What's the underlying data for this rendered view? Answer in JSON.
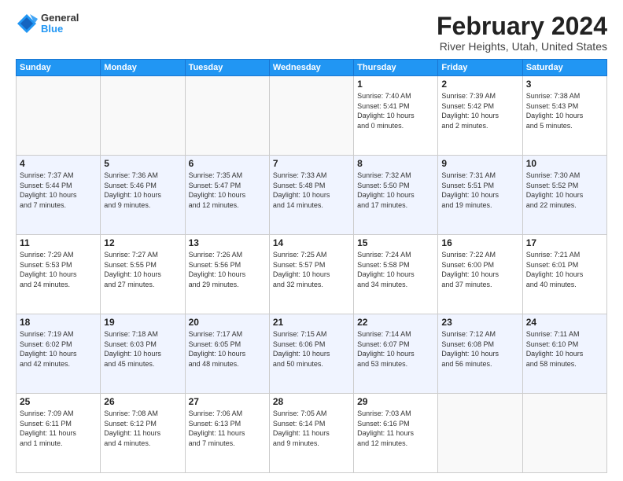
{
  "logo": {
    "general": "General",
    "blue": "Blue"
  },
  "header": {
    "title": "February 2024",
    "subtitle": "River Heights, Utah, United States"
  },
  "days_of_week": [
    "Sunday",
    "Monday",
    "Tuesday",
    "Wednesday",
    "Thursday",
    "Friday",
    "Saturday"
  ],
  "weeks": [
    [
      {
        "day": "",
        "detail": ""
      },
      {
        "day": "",
        "detail": ""
      },
      {
        "day": "",
        "detail": ""
      },
      {
        "day": "",
        "detail": ""
      },
      {
        "day": "1",
        "detail": "Sunrise: 7:40 AM\nSunset: 5:41 PM\nDaylight: 10 hours\nand 0 minutes."
      },
      {
        "day": "2",
        "detail": "Sunrise: 7:39 AM\nSunset: 5:42 PM\nDaylight: 10 hours\nand 2 minutes."
      },
      {
        "day": "3",
        "detail": "Sunrise: 7:38 AM\nSunset: 5:43 PM\nDaylight: 10 hours\nand 5 minutes."
      }
    ],
    [
      {
        "day": "4",
        "detail": "Sunrise: 7:37 AM\nSunset: 5:44 PM\nDaylight: 10 hours\nand 7 minutes."
      },
      {
        "day": "5",
        "detail": "Sunrise: 7:36 AM\nSunset: 5:46 PM\nDaylight: 10 hours\nand 9 minutes."
      },
      {
        "day": "6",
        "detail": "Sunrise: 7:35 AM\nSunset: 5:47 PM\nDaylight: 10 hours\nand 12 minutes."
      },
      {
        "day": "7",
        "detail": "Sunrise: 7:33 AM\nSunset: 5:48 PM\nDaylight: 10 hours\nand 14 minutes."
      },
      {
        "day": "8",
        "detail": "Sunrise: 7:32 AM\nSunset: 5:50 PM\nDaylight: 10 hours\nand 17 minutes."
      },
      {
        "day": "9",
        "detail": "Sunrise: 7:31 AM\nSunset: 5:51 PM\nDaylight: 10 hours\nand 19 minutes."
      },
      {
        "day": "10",
        "detail": "Sunrise: 7:30 AM\nSunset: 5:52 PM\nDaylight: 10 hours\nand 22 minutes."
      }
    ],
    [
      {
        "day": "11",
        "detail": "Sunrise: 7:29 AM\nSunset: 5:53 PM\nDaylight: 10 hours\nand 24 minutes."
      },
      {
        "day": "12",
        "detail": "Sunrise: 7:27 AM\nSunset: 5:55 PM\nDaylight: 10 hours\nand 27 minutes."
      },
      {
        "day": "13",
        "detail": "Sunrise: 7:26 AM\nSunset: 5:56 PM\nDaylight: 10 hours\nand 29 minutes."
      },
      {
        "day": "14",
        "detail": "Sunrise: 7:25 AM\nSunset: 5:57 PM\nDaylight: 10 hours\nand 32 minutes."
      },
      {
        "day": "15",
        "detail": "Sunrise: 7:24 AM\nSunset: 5:58 PM\nDaylight: 10 hours\nand 34 minutes."
      },
      {
        "day": "16",
        "detail": "Sunrise: 7:22 AM\nSunset: 6:00 PM\nDaylight: 10 hours\nand 37 minutes."
      },
      {
        "day": "17",
        "detail": "Sunrise: 7:21 AM\nSunset: 6:01 PM\nDaylight: 10 hours\nand 40 minutes."
      }
    ],
    [
      {
        "day": "18",
        "detail": "Sunrise: 7:19 AM\nSunset: 6:02 PM\nDaylight: 10 hours\nand 42 minutes."
      },
      {
        "day": "19",
        "detail": "Sunrise: 7:18 AM\nSunset: 6:03 PM\nDaylight: 10 hours\nand 45 minutes."
      },
      {
        "day": "20",
        "detail": "Sunrise: 7:17 AM\nSunset: 6:05 PM\nDaylight: 10 hours\nand 48 minutes."
      },
      {
        "day": "21",
        "detail": "Sunrise: 7:15 AM\nSunset: 6:06 PM\nDaylight: 10 hours\nand 50 minutes."
      },
      {
        "day": "22",
        "detail": "Sunrise: 7:14 AM\nSunset: 6:07 PM\nDaylight: 10 hours\nand 53 minutes."
      },
      {
        "day": "23",
        "detail": "Sunrise: 7:12 AM\nSunset: 6:08 PM\nDaylight: 10 hours\nand 56 minutes."
      },
      {
        "day": "24",
        "detail": "Sunrise: 7:11 AM\nSunset: 6:10 PM\nDaylight: 10 hours\nand 58 minutes."
      }
    ],
    [
      {
        "day": "25",
        "detail": "Sunrise: 7:09 AM\nSunset: 6:11 PM\nDaylight: 11 hours\nand 1 minute."
      },
      {
        "day": "26",
        "detail": "Sunrise: 7:08 AM\nSunset: 6:12 PM\nDaylight: 11 hours\nand 4 minutes."
      },
      {
        "day": "27",
        "detail": "Sunrise: 7:06 AM\nSunset: 6:13 PM\nDaylight: 11 hours\nand 7 minutes."
      },
      {
        "day": "28",
        "detail": "Sunrise: 7:05 AM\nSunset: 6:14 PM\nDaylight: 11 hours\nand 9 minutes."
      },
      {
        "day": "29",
        "detail": "Sunrise: 7:03 AM\nSunset: 6:16 PM\nDaylight: 11 hours\nand 12 minutes."
      },
      {
        "day": "",
        "detail": ""
      },
      {
        "day": "",
        "detail": ""
      }
    ]
  ]
}
